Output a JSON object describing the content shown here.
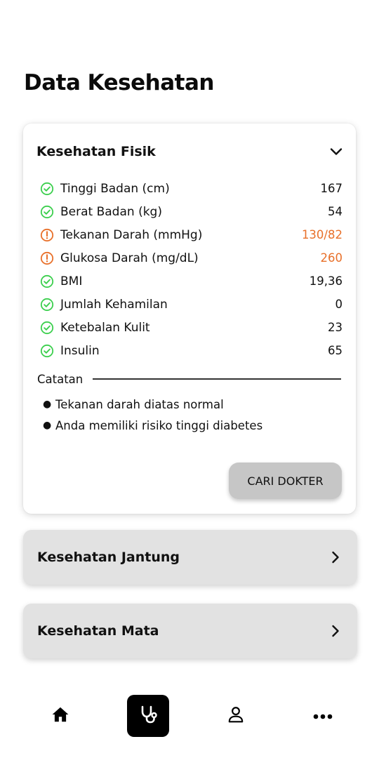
{
  "page": {
    "title": "Data Kesehatan"
  },
  "physical_card": {
    "title": "Kesehatan Fisik",
    "metrics": [
      {
        "label": "Tinggi Badan (cm)",
        "value": "167",
        "status": "ok"
      },
      {
        "label": "Berat Badan (kg)",
        "value": "54",
        "status": "ok"
      },
      {
        "label": "Tekanan Darah (mmHg)",
        "value": "130/82",
        "status": "warning"
      },
      {
        "label": "Glukosa Darah (mg/dL)",
        "value": "260",
        "status": "warning"
      },
      {
        "label": "BMI",
        "value": "19,36",
        "status": "ok"
      },
      {
        "label": "Jumlah Kehamilan",
        "value": "0",
        "status": "ok"
      },
      {
        "label": "Ketebalan Kulit",
        "value": "23",
        "status": "ok"
      },
      {
        "label": "Insulin",
        "value": "65",
        "status": "ok"
      }
    ],
    "notes_title": "Catatan",
    "notes": [
      "Tekanan darah diatas normal",
      "Anda memiliki risiko tinggi diabetes"
    ],
    "cta_label": "CARI DOKTER"
  },
  "sections": [
    {
      "label": "Kesehatan Jantung"
    },
    {
      "label": "Kesehatan Mata"
    }
  ],
  "bottom_nav": [
    {
      "icon": "home-icon"
    },
    {
      "icon": "stethoscope-icon",
      "active": true
    },
    {
      "icon": "user-icon"
    },
    {
      "icon": "more-icon"
    }
  ],
  "colors": {
    "ok": "#3ccf4e",
    "warning": "#e8702a",
    "active_nav_bg": "#000000"
  }
}
